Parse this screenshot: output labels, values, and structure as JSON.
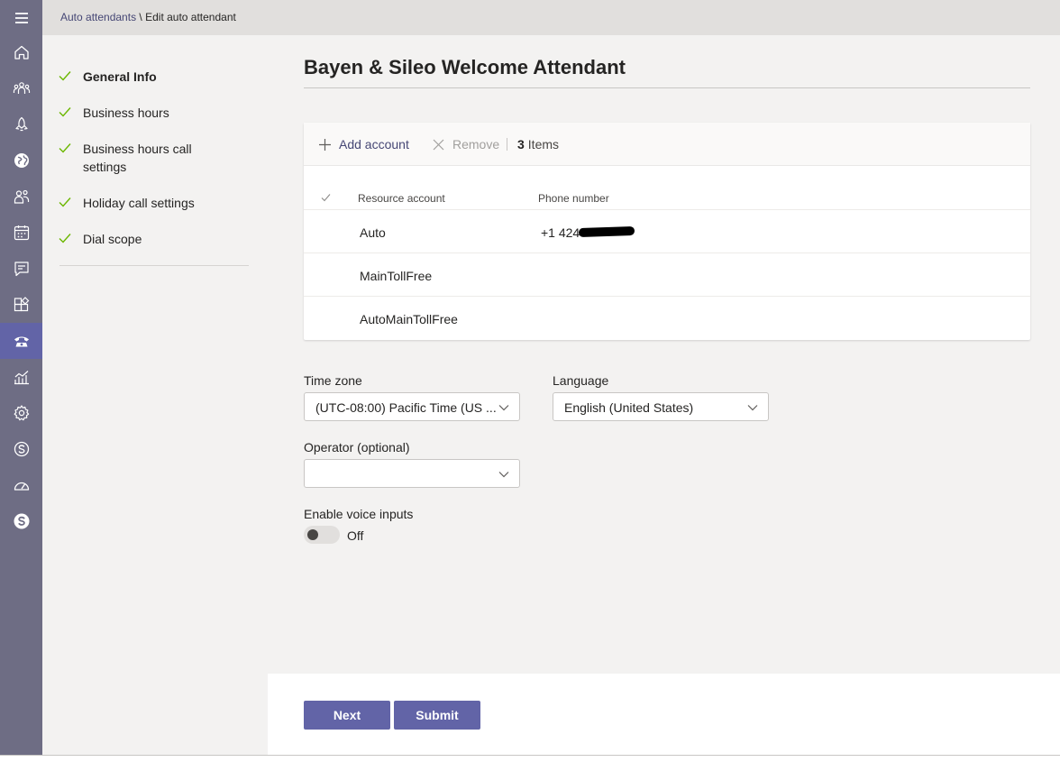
{
  "breadcrumb": {
    "parent": "Auto attendants",
    "separator": " \\ ",
    "current": "Edit auto attendant"
  },
  "rail": {
    "items": [
      {
        "icon": "menu-icon"
      },
      {
        "icon": "home-icon"
      },
      {
        "icon": "teams-icon"
      },
      {
        "icon": "deployment-icon"
      },
      {
        "icon": "globe-icon"
      },
      {
        "icon": "users-icon"
      },
      {
        "icon": "calendar-icon"
      },
      {
        "icon": "messaging-icon"
      },
      {
        "icon": "apps-icon"
      },
      {
        "icon": "voice-icon",
        "active": true
      },
      {
        "icon": "analytics-icon"
      },
      {
        "icon": "settings-icon"
      },
      {
        "icon": "skype-icon"
      },
      {
        "icon": "dashboard-icon"
      },
      {
        "icon": "skype-business-icon"
      }
    ]
  },
  "steps": [
    {
      "label": "General Info",
      "current": true
    },
    {
      "label": "Business hours"
    },
    {
      "label": "Business hours call settings"
    },
    {
      "label": "Holiday call settings"
    },
    {
      "label": "Dial scope"
    }
  ],
  "page": {
    "title": "Bayen & Sileo Welcome Attendant"
  },
  "accounts": {
    "add_label": "Add account",
    "remove_label": "Remove",
    "count": "3",
    "count_suffix": "Items",
    "columns": {
      "account": "Resource account",
      "phone": "Phone number"
    },
    "rows": [
      {
        "account": "Auto",
        "phone": "+1 424"
      },
      {
        "account": "MainTollFree",
        "phone": ""
      },
      {
        "account": "AutoMainTollFree",
        "phone": ""
      }
    ]
  },
  "time_zone": {
    "label": "Time zone",
    "value": "(UTC-08:00) Pacific Time (US ..."
  },
  "language": {
    "label": "Language",
    "value": "English (United States)"
  },
  "operator": {
    "label": "Operator (optional)",
    "value": ""
  },
  "voice_inputs": {
    "label": "Enable voice inputs",
    "state": "Off",
    "enabled": false
  },
  "footer": {
    "next_label": "Next",
    "submit_label": "Submit"
  },
  "colors": {
    "accent": "#6264a7",
    "rail": "#6e6d84",
    "check": "#6bb700"
  }
}
